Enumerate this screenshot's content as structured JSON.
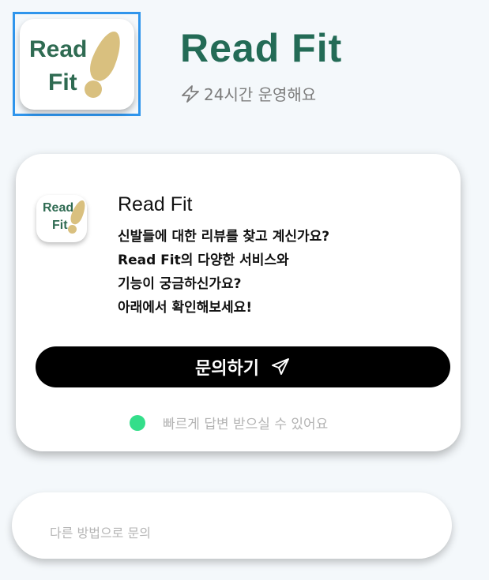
{
  "header": {
    "logo_text": [
      "Read",
      "Fit"
    ],
    "title": "Read Fit",
    "subtitle": "24시간 운영해요",
    "subtitle_icon": "lightning-bolt-icon"
  },
  "card": {
    "logo_text": [
      "Read",
      "Fit"
    ],
    "title": "Read Fit",
    "description_lines": [
      "신발들에 대한 리뷰를 찾고 계신가요?",
      "Read Fit의 다양한 서비스와",
      "기능이 궁금하신가요?",
      "아래에서 확인해보세요!"
    ],
    "button_label": "문의하기",
    "button_icon": "send-icon",
    "status_text": "빠르게 답변 받으실 수 있어요",
    "status_color": "#34de8a"
  },
  "other": {
    "label": "다른 방법으로 문의"
  },
  "colors": {
    "brand": "#236b56",
    "logo_shoe": "#d9c07f",
    "selection": "#2f95ec",
    "button": "#000000"
  }
}
